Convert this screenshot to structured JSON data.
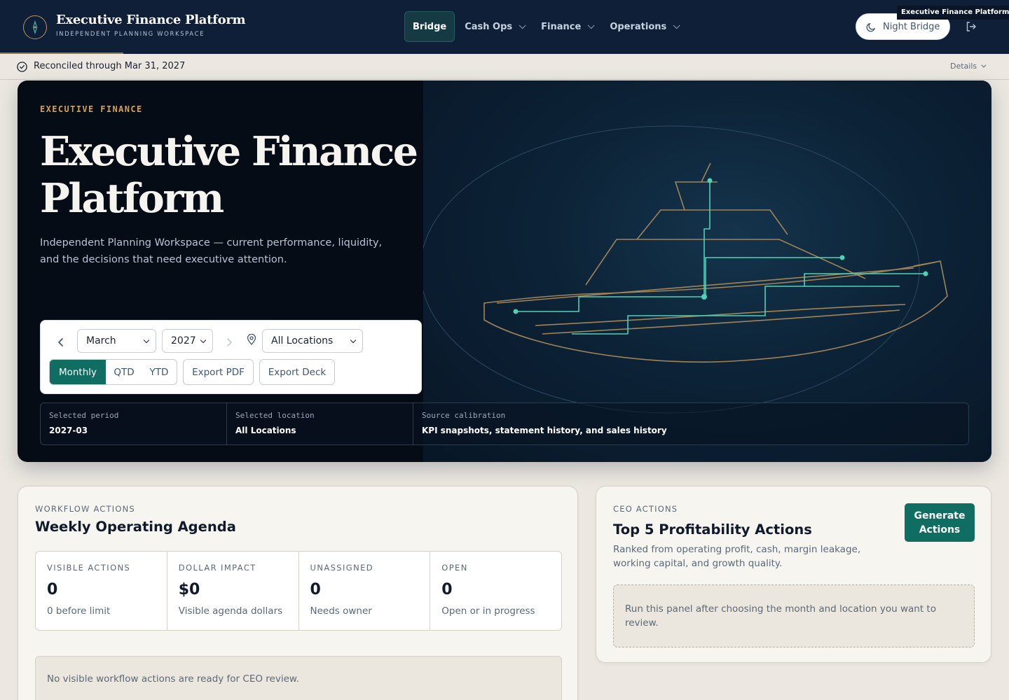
{
  "brand": {
    "title": "Executive Finance Platform",
    "subtitle": "INDEPENDENT PLANNING WORKSPACE"
  },
  "nav": {
    "items": [
      {
        "label": "Bridge",
        "active": true
      },
      {
        "label": "Cash Ops"
      },
      {
        "label": "Finance"
      },
      {
        "label": "Operations"
      }
    ],
    "theme_button": "Night Bridge",
    "tooltip": "Executive Finance Platform"
  },
  "status": {
    "text": "Reconciled through Mar 31, 2027",
    "details": "Details"
  },
  "hero": {
    "eyebrow": "EXECUTIVE FINANCE",
    "title": "Executive Finance Platform",
    "description": "Independent Planning Workspace — current performance, liquidity, and the decisions that need executive attention.",
    "controls": {
      "month": "March",
      "year": "2027",
      "location": "All Locations",
      "periods": [
        "Monthly",
        "QTD",
        "YTD"
      ],
      "active_period": "Monthly",
      "export_pdf": "Export PDF",
      "export_deck": "Export Deck"
    },
    "meta": [
      {
        "label": "Selected period",
        "value": "2027-03"
      },
      {
        "label": "Selected location",
        "value": "All Locations"
      },
      {
        "label": "Source calibration",
        "value": "KPI snapshots, statement history, and sales history"
      }
    ]
  },
  "workflow": {
    "eyebrow": "WORKFLOW ACTIONS",
    "title": "Weekly Operating Agenda",
    "kpis": [
      {
        "label": "VISIBLE ACTIONS",
        "value": "0",
        "sub": "0 before limit"
      },
      {
        "label": "DOLLAR IMPACT",
        "value": "$0",
        "sub": "Visible agenda dollars"
      },
      {
        "label": "UNASSIGNED",
        "value": "0",
        "sub": "Needs owner"
      },
      {
        "label": "OPEN",
        "value": "0",
        "sub": "Open or in progress"
      }
    ],
    "empty": "No visible workflow actions are ready for CEO review."
  },
  "ceo": {
    "eyebrow": "CEO ACTIONS",
    "title": "Top 5 Profitability Actions",
    "description": "Ranked from operating profit, cash, margin leakage, working capital, and growth quality.",
    "button": "Generate Actions",
    "hint": "Run this panel after choosing the month and location you want to review."
  },
  "colors": {
    "nav_bg": "#0f1f38",
    "accent_teal": "#0f6e61",
    "accent_gold": "#d9a04a",
    "page_bg": "#ece8e1"
  }
}
